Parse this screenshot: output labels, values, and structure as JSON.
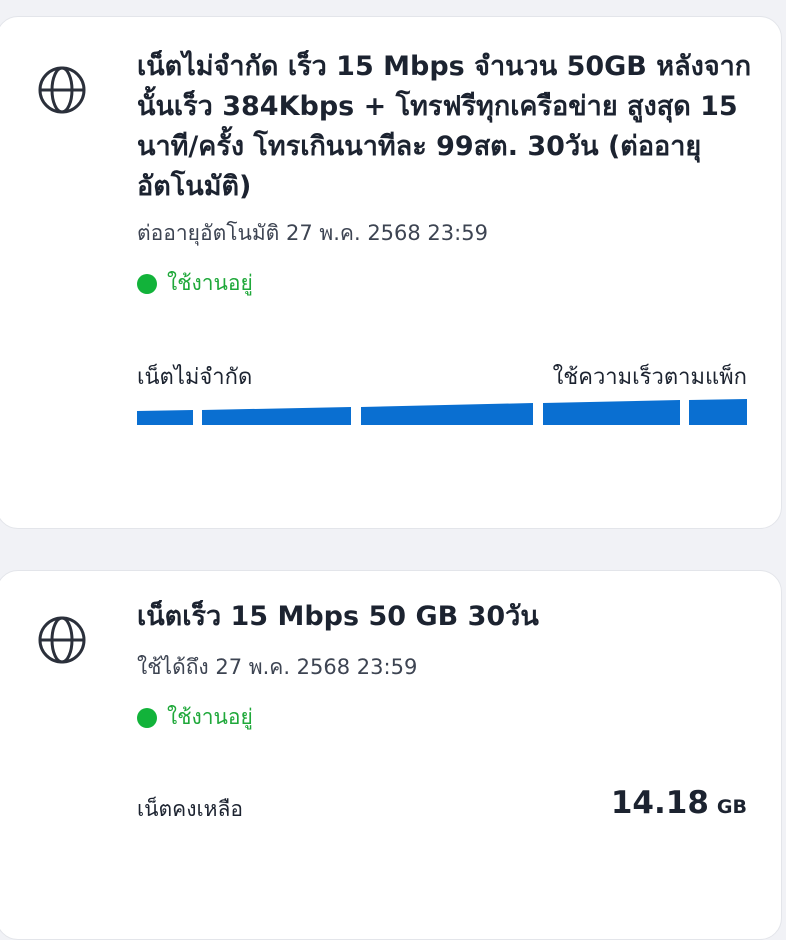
{
  "packages": [
    {
      "title": "เน็ตไม่จำกัด เร็ว 15 Mbps จำนวน 50GB หลังจากนั้นเร็ว 384Kbps + โทรฟรีทุกเครือข่าย สูงสุด 15 นาที/ครั้ง โทรเกินนาทีละ 99สต. 30วัน (ต่ออายุอัตโนมัติ)",
      "renew_text": "ต่ออายุอัตโนมัติ 27 พ.ค. 2568 23:59",
      "status": "ใช้งานอยู่",
      "usage_left_label": "เน็ตไม่จำกัด",
      "usage_right_label": "ใช้ความเร็วตามแพ็ก",
      "icon": "globe-icon"
    },
    {
      "title": "เน็ตเร็ว 15 Mbps 50 GB 30วัน",
      "renew_text": "ใช้ได้ถึง 27 พ.ค. 2568 23:59",
      "status": "ใช้งานอยู่",
      "remaining_label": "เน็ตคงเหลือ",
      "remaining_value": "14.18",
      "remaining_unit": "GB",
      "icon": "globe-icon"
    }
  ],
  "colors": {
    "status_green": "#12b33a",
    "bar_blue": "#0a6fd1"
  }
}
